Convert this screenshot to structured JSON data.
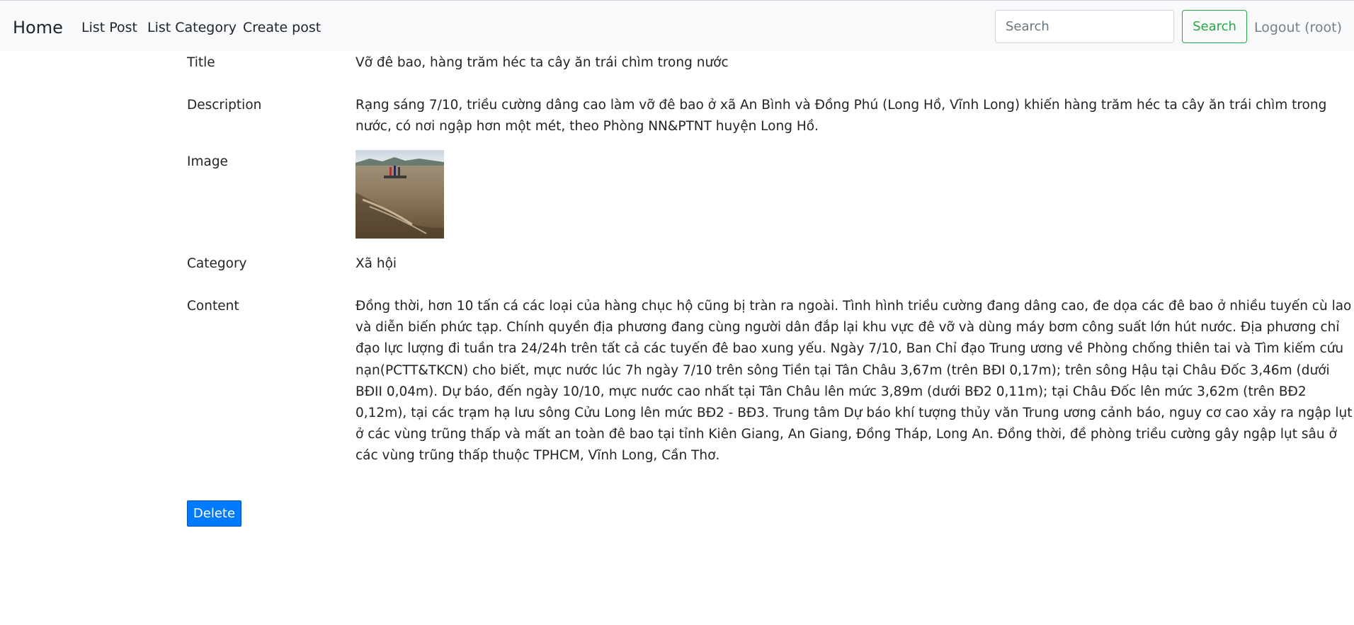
{
  "navbar": {
    "brand": "Home",
    "links": [
      {
        "label": "List Post"
      },
      {
        "label": "List Category"
      },
      {
        "label": "Create post"
      }
    ],
    "search": {
      "placeholder": "Search",
      "value": "",
      "button_label": "Search"
    },
    "logout_label": "Logout (root)"
  },
  "post": {
    "title_label": "Title",
    "title": "Vỡ đê bao, hàng trăm héc ta cây ăn trái chìm trong nước",
    "description_label": "Description",
    "description": "Rạng sáng 7/10, triều cường dâng cao làm vỡ đê bao ở xã An Bình và Đồng Phú (Long Hồ, Vĩnh Long) khiến hàng trăm héc ta cây ăn trái chìm trong nước, có nơi ngập hơn một mét, theo Phòng NN&PTNT huyện Long Hồ.",
    "image_label": "Image",
    "category_label": "Category",
    "category": "Xã hội",
    "content_label": "Content",
    "content": "Đồng thời, hơn 10 tấn cá các loại của hàng chục hộ cũng bị tràn ra ngoài. Tình hình triều cường đang dâng cao, đe dọa các đê bao ở nhiều tuyến cù lao và diễn biến phức tạp. Chính quyền địa phương đang cùng người dân đắp lại khu vực đê vỡ và dùng máy bơm công suất lớn hút nước. Địa phương chỉ đạo lực lượng đi tuần tra 24/24h trên tất cả các tuyến đê bao xung yếu. Ngày 7/10, Ban Chỉ đạo Trung ương về Phòng chống thiên tai và Tìm kiếm cứu nạn(PCTT&TKCN) cho biết, mực nước lúc 7h ngày 7/10 trên sông Tiền tại Tân Châu 3,67m (trên BĐI 0,17m); trên sông Hậu tại Châu Đốc 3,46m (dưới BĐII 0,04m). Dự báo, đến ngày 10/10, mực nước cao nhất tại Tân Châu lên mức 3,89m (dưới BĐ2 0,11m); tại Châu Đốc lên mức 3,62m (trên BĐ2 0,12m), tại các trạm hạ lưu sông Cửu Long lên mức BĐ2 - BĐ3. Trung tâm Dự báo khí tượng thủy văn Trung ương cảnh báo, nguy cơ cao xảy ra ngập lụt ở các vùng trũng thấp và mất an toàn đê bao tại tỉnh Kiên Giang, An Giang, Đồng Tháp, Long An. Đồng thời, đề phòng triều cường gây ngập lụt sâu ở các vùng trũng thấp thuộc TPHCM, Vĩnh Long, Cần Thơ."
  },
  "actions": {
    "delete_label": "Delete"
  },
  "colors": {
    "navbar_bg": "#f8f9fa",
    "search_button": "#28a745",
    "delete_button": "#007bff",
    "logout_text": "#7a7f85"
  }
}
